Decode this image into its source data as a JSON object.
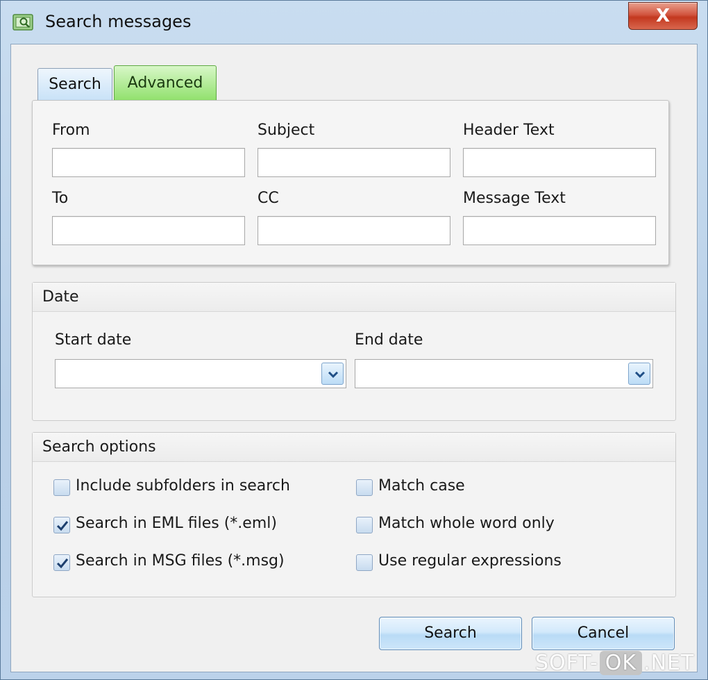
{
  "window": {
    "title": "Search messages",
    "close_symbol": "X",
    "app_icon": "folder-search-icon"
  },
  "tabs": [
    {
      "label": "Search",
      "active": false
    },
    {
      "label": "Advanced",
      "active": true
    }
  ],
  "advanced": {
    "fields": [
      {
        "label": "From",
        "value": ""
      },
      {
        "label": "Subject",
        "value": ""
      },
      {
        "label": "Header Text",
        "value": ""
      },
      {
        "label": "To",
        "value": ""
      },
      {
        "label": "CC",
        "value": ""
      },
      {
        "label": "Message Text",
        "value": ""
      }
    ]
  },
  "date": {
    "title": "Date",
    "start_label": "Start date",
    "start_value": "",
    "end_label": "End date",
    "end_value": ""
  },
  "options": {
    "title": "Search options",
    "items": [
      {
        "label": "Include subfolders in search",
        "checked": false
      },
      {
        "label": "Search in EML files (*.eml)",
        "checked": true
      },
      {
        "label": "Search in MSG files (*.msg)",
        "checked": true
      },
      {
        "label": "Match case",
        "checked": false
      },
      {
        "label": "Match whole word only",
        "checked": false
      },
      {
        "label": "Use regular expressions",
        "checked": false
      }
    ]
  },
  "buttons": {
    "search_label": "Search",
    "cancel_label": "Cancel"
  },
  "watermark": {
    "left": "SOFT-",
    "middle": "OK",
    "right": ".NET"
  },
  "colors": {
    "active_tab": "#8fe06a",
    "button_blue": "#b9dbf6",
    "close_red": "#c3381f"
  }
}
